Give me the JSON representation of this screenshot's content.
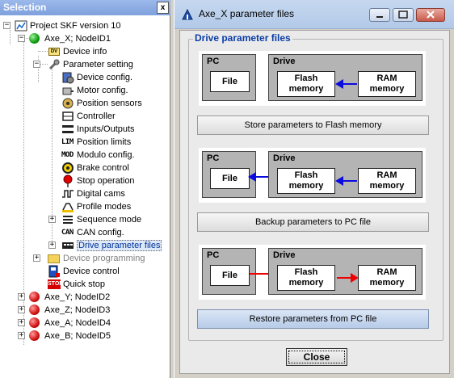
{
  "selection_panel": {
    "title": "Selection",
    "close_label": "x",
    "tree": {
      "project": "Project SKF version 10",
      "axe_x": "Axe_X; NodeID1",
      "device_info": "Device info",
      "parameter_setting": "Parameter setting",
      "params": [
        "Device config.",
        "Motor config.",
        "Position sensors",
        "Controller",
        "Inputs/Outputs",
        "Position limits",
        "Modulo config.",
        "Brake control",
        "Stop operation",
        "Digital cams",
        "Profile modes",
        "Sequence mode",
        "CAN config.",
        "Drive parameter files"
      ],
      "param_icon_texts": {
        "position_limits": "LIM",
        "modulo_config": "MOD",
        "can_config": "CAN",
        "device_info": "DV"
      },
      "device_programming": "Device programming",
      "device_control": "Device control",
      "quick_stop": "Quick stop",
      "stop_icon_text": "STOP",
      "other_axes": [
        "Axe_Y; NodeID2",
        "Axe_Z; NodeID3",
        "Axe_A; NodeID4",
        "Axe_B; NodeID5"
      ]
    }
  },
  "dialog": {
    "title": "Axe_X parameter files",
    "group_title": "Drive parameter files",
    "pc_label": "PC",
    "drive_label": "Drive",
    "file_label": "File",
    "flash_label": "Flash memory",
    "ram_label": "RAM memory",
    "store_button": "Store parameters to Flash memory",
    "backup_button": "Backup parameters to PC file",
    "restore_button": "Restore parameters from PC file",
    "close_button": "Close",
    "colors": {
      "arrow_blue": "#0b0be0",
      "arrow_red": "#ee0000",
      "group_title": "#0a3ca8"
    }
  }
}
